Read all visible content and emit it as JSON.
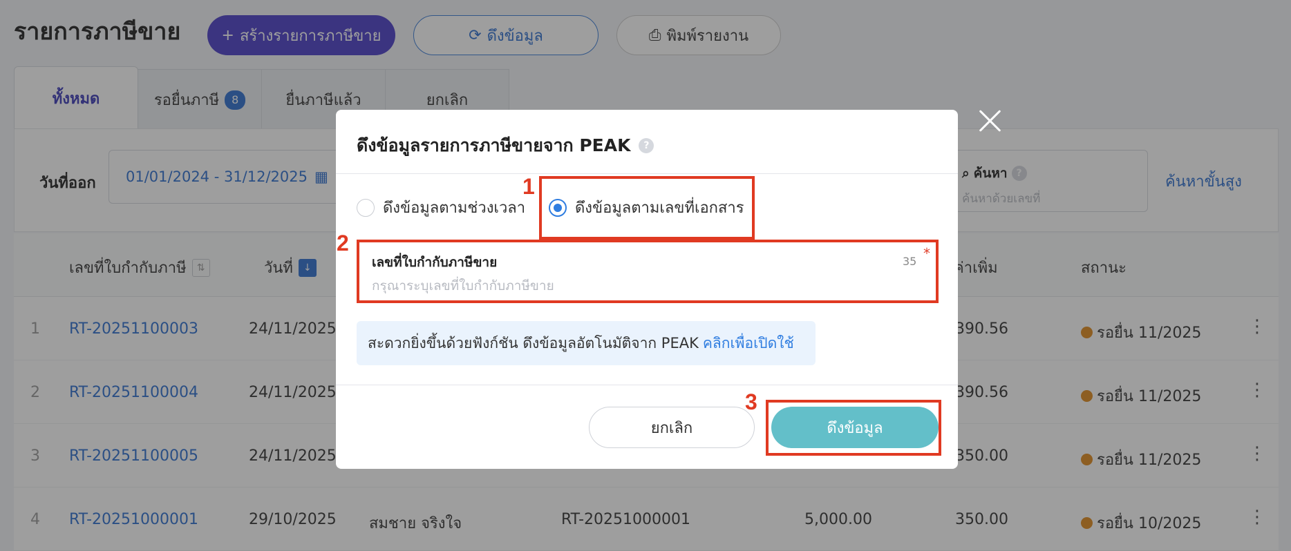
{
  "page": {
    "title": "รายการภาษีขาย",
    "create_button": "สร้างรายการภาษีขาย",
    "fetch_button": "ดึงข้อมูล",
    "print_button": "พิมพ์รายงาน"
  },
  "tabs": [
    {
      "label": "ทั้งหมด"
    },
    {
      "label": "รอยื่นภาษี",
      "badge": "8"
    },
    {
      "label": "ยื่นภาษีแล้ว"
    },
    {
      "label": "ยกเลิก"
    }
  ],
  "filters": {
    "date_label": "วันที่ออก",
    "date_range": "01/01/2024 - 31/12/2025",
    "search_title": "ค้นหา",
    "search_placeholder": "ค้นหาด้วยเลขที่",
    "advanced_search": "ค้นหาขั้นสูง"
  },
  "table": {
    "columns": {
      "invoice_no": "เลขที่ใบกำกับภาษี",
      "date": "วันที่",
      "vat": "ค่าเพิ่ม",
      "status": "สถานะ"
    },
    "rows": [
      {
        "num": "1",
        "invoice_no": "RT-20251100003",
        "date": "24/11/2025",
        "customer": "",
        "ref": "",
        "amount": "",
        "vat": "390.56",
        "status": "รอยื่น 11/2025"
      },
      {
        "num": "2",
        "invoice_no": "RT-20251100004",
        "date": "24/11/2025",
        "customer": "",
        "ref": "",
        "amount": "",
        "vat": "390.56",
        "status": "รอยื่น 11/2025"
      },
      {
        "num": "3",
        "invoice_no": "RT-20251100005",
        "date": "24/11/2025",
        "customer": "",
        "ref": "",
        "amount": "",
        "vat": "350.00",
        "status": "รอยื่น 11/2025"
      },
      {
        "num": "4",
        "invoice_no": "RT-20251000001",
        "date": "29/10/2025",
        "customer": "สมชาย จริงใจ",
        "ref": "RT-20251000001",
        "amount": "5,000.00",
        "vat": "350.00",
        "status": "รอยื่น 10/2025"
      }
    ]
  },
  "modal": {
    "title": "ดึงข้อมูลรายการภาษีขายจาก PEAK",
    "option_time": "ดึงข้อมูลตามช่วงเวลา",
    "option_docno": "ดึงข้อมูลตามเลขที่เอกสาร",
    "field_label": "เลขที่ใบกำกับภาษีขาย",
    "field_counter": "35",
    "field_required": "*",
    "field_placeholder": "กรุณาระบุเลขที่ใบกำกับภาษีขาย",
    "info_text": "สะดวกยิ่งขึ้นด้วยฟังก์ชัน ดึงข้อมูลอัตโนมัติจาก PEAK",
    "info_link": "คลิกเพื่อเปิดใช้",
    "cancel_button": "ยกเลิก",
    "submit_button": "ดึงข้อมูล"
  },
  "annotations": [
    "1",
    "2",
    "3"
  ],
  "colors": {
    "primary": "#4b3fc8",
    "link": "#2f6fd0",
    "submit": "#63bfc9",
    "annotation": "#e03a22",
    "status_dot": "#e08a1e"
  }
}
